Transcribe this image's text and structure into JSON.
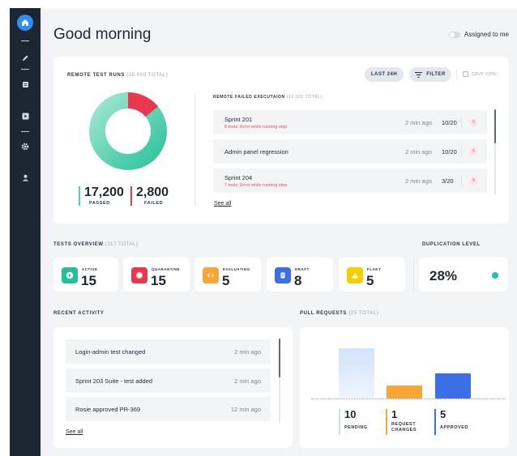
{
  "header": {
    "greeting": "Good morning",
    "assigned_label": "Assigned to me"
  },
  "remote_runs": {
    "title": "REMOTE TEST RUNS",
    "total": "(20.000 TOTAL)",
    "passed": {
      "value": "17,200",
      "label": "PASSED"
    },
    "failed": {
      "value": "2,800",
      "label": "FAILED"
    },
    "donut": {
      "passed": 17200,
      "failed": 2800
    }
  },
  "toolbar": {
    "last24_label": "LAST 24H",
    "filter_label": "FILTER",
    "save_view_label": "save view"
  },
  "failed": {
    "title": "REMOTE FAILED EXECUTAION",
    "total": "(10,000 TOTAL)",
    "rows": [
      {
        "name": "Sprint 201",
        "error": "8 tests: Error while running step",
        "time": "2 min ago",
        "ratio": "10/20",
        "badge": "5"
      },
      {
        "name": "Admin panel regression",
        "error": "",
        "time": "2 min ago",
        "ratio": "10/20",
        "badge": "5"
      },
      {
        "name": "Sprint 204",
        "error": "7 tests: Error while running step",
        "time": "2 min ago",
        "ratio": "3/20",
        "badge": "5"
      }
    ],
    "see_all": "See all"
  },
  "overview": {
    "title": "TESTS OVERVIEW",
    "total": "(117 TOTAL)",
    "cards": [
      {
        "label": "ACTIVE",
        "value": "15",
        "color": "#22c09a",
        "icon": "play-icon"
      },
      {
        "label": "QUARANTINE",
        "value": "15",
        "color": "#e8384f",
        "icon": "cube-icon"
      },
      {
        "label": "EVALUATING",
        "value": "5",
        "color": "#f7a63a",
        "icon": "code-icon"
      },
      {
        "label": "DRAFT",
        "value": "8",
        "color": "#3b6fe8",
        "icon": "document-icon"
      },
      {
        "label": "FLAKY",
        "value": "5",
        "color": "#f5d000",
        "icon": "warning-icon"
      }
    ]
  },
  "duplication": {
    "title": "DUPLICATION LEVEL",
    "value": "28%"
  },
  "activity": {
    "title": "RECENT ACTIVITY",
    "rows": [
      {
        "name": "Login-admin test changed",
        "time": "2 min ago"
      },
      {
        "name": "Sprint 203 Suite - test added",
        "time": "2 min ago"
      },
      {
        "name": "Rosie approved PR-369",
        "time": "12 min ago"
      }
    ],
    "see_all": "See all"
  },
  "pull_requests": {
    "title": "PULL REQUESTS",
    "total": "(25 TOTAL)",
    "stats": [
      {
        "value": "10",
        "label": "PENDING",
        "color": "#c9dcf7"
      },
      {
        "value": "1",
        "label": "REQUEST CHANGES",
        "color": "#f7a63a"
      },
      {
        "value": "5",
        "label": "APPROVED",
        "color": "#3b6fe8"
      }
    ],
    "chart_values": [
      10,
      1,
      5
    ]
  },
  "colors": {
    "sidebar": "#1d2633",
    "passed": "#4fd3b0",
    "failed": "#e8384f",
    "accent": "#2f8ef2"
  }
}
